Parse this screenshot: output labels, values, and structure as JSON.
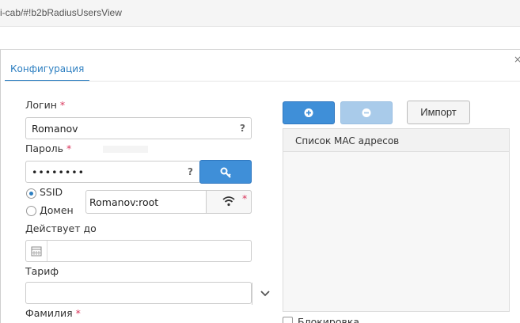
{
  "browser": {
    "url_fragment": "i-cab/#!b2bRadiusUsersView"
  },
  "dialog": {
    "tab_label": "Конфигурация",
    "close_glyph": "×"
  },
  "form": {
    "login_label": "Логин",
    "login_value": "Romanov",
    "password_label": "Пароль",
    "password_value": "••••••••",
    "required_mark": "*",
    "help_glyph": "?",
    "ssid_label": "SSID",
    "domain_label": "Домен",
    "ssid_mode": "SSID",
    "ssid_value": "Romanov:root",
    "valid_until_label": "Действует до",
    "valid_until_value": "",
    "tariff_label": "Тариф",
    "tariff_value": "",
    "surname_label": "Фамилия"
  },
  "mac": {
    "import_label": "Импорт",
    "list_header": "Список MAC адресов",
    "block_label": "Блокировка"
  },
  "icons": {
    "add": "plus-circle-icon",
    "remove": "minus-circle-icon",
    "key": "key-icon",
    "wifi": "wifi-icon",
    "calendar": "calendar-icon",
    "chevron": "chevron-down-icon"
  },
  "colors": {
    "accent": "#2d7fc1",
    "primary_button": "#3f8fd8",
    "disabled_button": "#a9cbea",
    "required": "#d9345a"
  }
}
